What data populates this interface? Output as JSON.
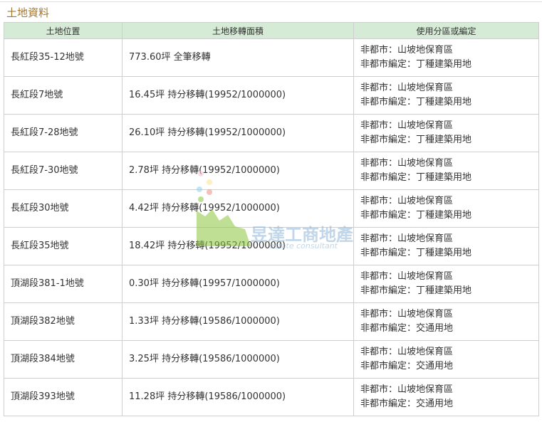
{
  "section_title": "土地資料",
  "table": {
    "headers": [
      "土地位置",
      "土地移轉面積",
      "使用分區或編定"
    ],
    "rows": [
      {
        "location": "長紅段35-12地號",
        "area": "773.60坪 全筆移轉",
        "zone": "非都市：山坡地保育區",
        "designation": "非都市編定：丁種建築用地"
      },
      {
        "location": "長紅段7地號",
        "area": "16.45坪 持分移轉(19952/1000000)",
        "zone": "非都市：山坡地保育區",
        "designation": "非都市編定：丁種建築用地"
      },
      {
        "location": "長紅段7-28地號",
        "area": "26.10坪 持分移轉(19952/1000000)",
        "zone": "非都市：山坡地保育區",
        "designation": "非都市編定：丁種建築用地"
      },
      {
        "location": "長紅段7-30地號",
        "area": "2.78坪 持分移轉(19952/1000000)",
        "zone": "非都市：山坡地保育區",
        "designation": "非都市編定：丁種建築用地"
      },
      {
        "location": "長紅段30地號",
        "area": "4.42坪 持分移轉(19952/1000000)",
        "zone": "非都市：山坡地保育區",
        "designation": "非都市編定：丁種建築用地"
      },
      {
        "location": "長紅段35地號",
        "area": "18.42坪 持分移轉(19952/1000000)",
        "zone": "非都市：山坡地保育區",
        "designation": "非都市編定：丁種建築用地"
      },
      {
        "location": "頂湖段381-1地號",
        "area": "0.30坪 持分移轉(19957/1000000)",
        "zone": "非都市：山坡地保育區",
        "designation": "非都市編定：丁種建築用地"
      },
      {
        "location": "頂湖段382地號",
        "area": "1.33坪 持分移轉(19586/1000000)",
        "zone": "非都市：山坡地保育區",
        "designation": "非都市編定：交通用地"
      },
      {
        "location": "頂湖段384地號",
        "area": "3.25坪 持分移轉(19586/1000000)",
        "zone": "非都市：山坡地保育區",
        "designation": "非都市編定：交通用地"
      },
      {
        "location": "頂湖段393地號",
        "area": "11.28坪 持分移轉(19586/1000000)",
        "zone": "非都市：山坡地保育區",
        "designation": "非都市編定：交通用地"
      }
    ]
  },
  "watermark": {
    "company": "昱達工商地產",
    "subtitle": "estate consultant",
    "colors": [
      "#8cc63f",
      "#f7c6d0",
      "#fde28a",
      "#8fd0e8",
      "#f28b82"
    ]
  }
}
